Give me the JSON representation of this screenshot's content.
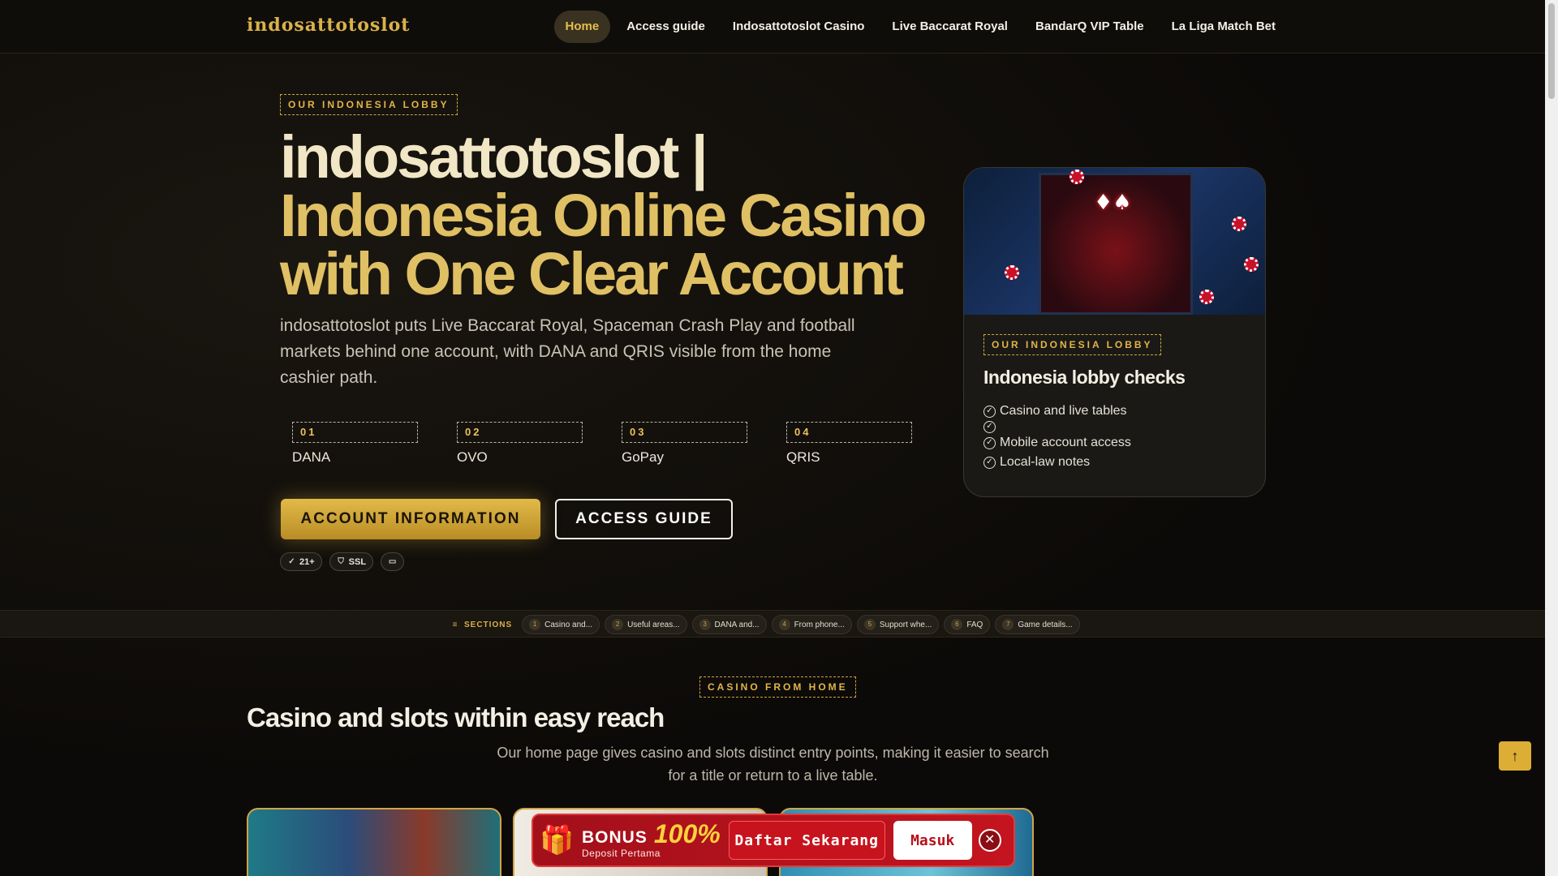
{
  "nav": {
    "logo": "indosattotoslot",
    "items": [
      {
        "label": "Home",
        "active": true
      },
      {
        "label": "Access guide"
      },
      {
        "label": "Indosattotoslot Casino"
      },
      {
        "label": "Live Baccarat Royal"
      },
      {
        "label": "BandarQ VIP Table"
      },
      {
        "label": "La Liga Match Bet"
      }
    ]
  },
  "hero": {
    "tag": "OUR INDONESIA LOBBY",
    "title_line1": "indosattotoslot |",
    "title_line2": "Indonesia Online Casino",
    "title_line3": "with One Clear Account",
    "lead": "indosattotoslot puts Live Baccarat Royal, Spaceman Crash Play and football markets behind one account, with DANA and QRIS visible from the home cashier path.",
    "payments": [
      {
        "num": "01",
        "name": "DANA"
      },
      {
        "num": "02",
        "name": "OVO"
      },
      {
        "num": "03",
        "name": "GoPay"
      },
      {
        "num": "04",
        "name": "QRIS"
      }
    ],
    "primary_button": "ACCOUNT INFORMATION",
    "secondary_button": "ACCESS GUIDE",
    "badges": {
      "age": "21+",
      "ssl": "SSL"
    }
  },
  "lobby_card": {
    "tag": "OUR INDONESIA LOBBY",
    "title": "Indonesia lobby checks",
    "checks": [
      "Casino and live tables",
      "",
      "Mobile account access",
      "Local-law notes"
    ]
  },
  "sections": {
    "label": "SECTIONS",
    "items": [
      {
        "n": "1",
        "label": "Casino and..."
      },
      {
        "n": "2",
        "label": "Useful areas..."
      },
      {
        "n": "3",
        "label": "DANA and..."
      },
      {
        "n": "4",
        "label": "From phone..."
      },
      {
        "n": "5",
        "label": "Support whe..."
      },
      {
        "n": "6",
        "label": "FAQ"
      },
      {
        "n": "7",
        "label": "Game details..."
      }
    ]
  },
  "casino": {
    "tag": "CASINO FROM HOME",
    "title": "Casino and slots within easy reach",
    "subtitle": "Our home page gives casino and slots distinct entry points, making it easier to search for a title or return to a live table."
  },
  "bonus": {
    "label": "BONUS",
    "percent": "100%",
    "sub": "Deposit Pertama",
    "register": "Daftar Sekarang",
    "login": "Masuk"
  },
  "colors": {
    "accent": "#e2b94a",
    "bonus_red": "#c4141f"
  }
}
